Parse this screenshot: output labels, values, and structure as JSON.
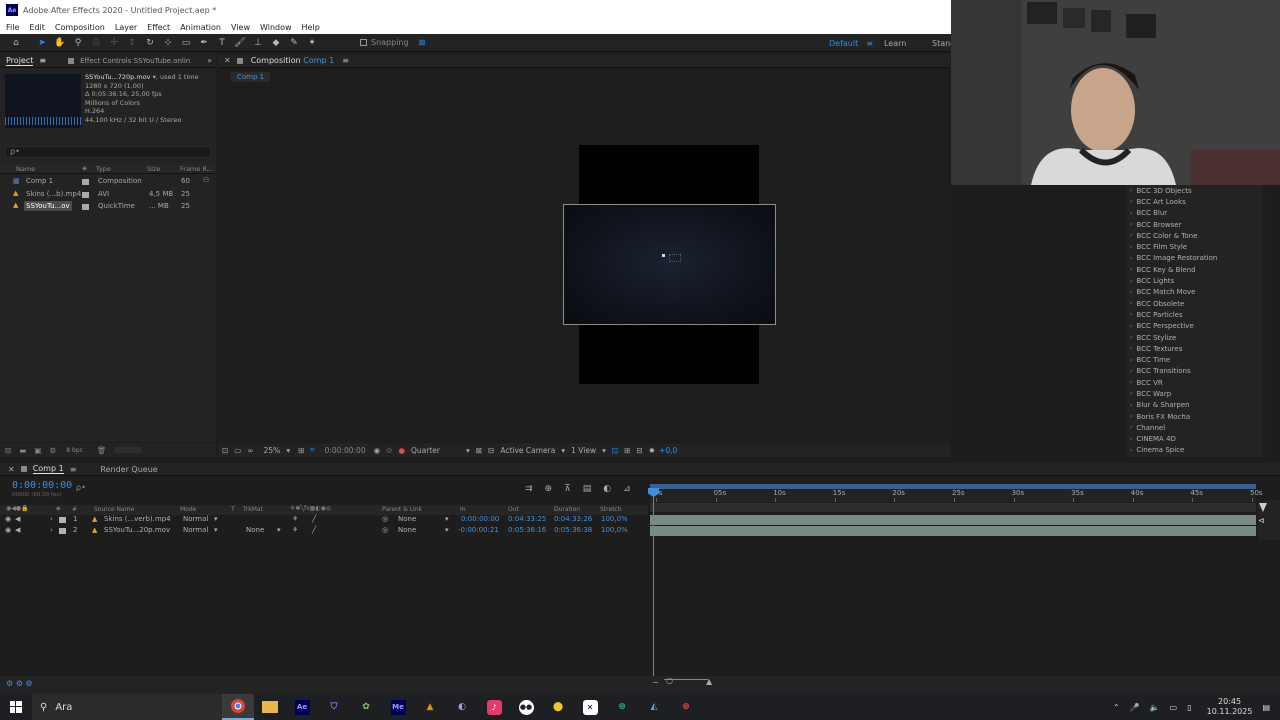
{
  "window": {
    "title": "Adobe After Effects 2020 - Untitled Project.aep *",
    "logo": "Ae"
  },
  "menu": [
    "File",
    "Edit",
    "Composition",
    "Layer",
    "Effect",
    "Animation",
    "View",
    "Window",
    "Help"
  ],
  "toolbar": {
    "snapping": "Snapping",
    "workspace": "Default",
    "learn": "Learn",
    "standard": "Stand"
  },
  "project": {
    "tab": "Project",
    "effect_controls_tab": "Effect Controls SSYouTube.onlin",
    "footage": {
      "name": "SSYouTu...720p.mov",
      "used": ", used 1 time",
      "dims": "1280 x 720 (1,00)",
      "duration": "Δ 0:05:36:16, 25,00 fps",
      "colors": "Millions of Colors",
      "codec": "H.264",
      "audio": "44,100 kHz / 32 bit U / Stereo"
    },
    "search_placeholder": "ρ•",
    "columns": {
      "name": "Name",
      "type": "Type",
      "size": "Size",
      "frame": "Frame R..."
    },
    "items": [
      {
        "name": "Comp 1",
        "type": "Composition",
        "size": "",
        "frame": "60",
        "color": "#5a8bc0"
      },
      {
        "name": "Skins (...b).mp4",
        "type": "AVI",
        "size": "4,5 MB",
        "frame": "25",
        "color": "#e0a030"
      },
      {
        "name": "SSYouTu...ov",
        "type": "QuickTime",
        "size": "... MB",
        "frame": "25",
        "color": "#e0a030"
      }
    ],
    "bpc": "8 bpc"
  },
  "composition": {
    "tab_prefix": "Composition",
    "tab_name": "Comp 1",
    "breadcrumb": "Comp 1"
  },
  "viewer": {
    "zoom": "25%",
    "timecode": "0:00:00:00",
    "resolution": "Quarter",
    "camera": "Active Camera",
    "views": "1 View",
    "exposure": "+0,0"
  },
  "effects": [
    "BCC 3D Objects",
    "BCC Art Looks",
    "BCC Blur",
    "BCC Browser",
    "BCC Color & Tone",
    "BCC Film Style",
    "BCC Image Restoration",
    "BCC Key & Blend",
    "BCC Lights",
    "BCC Match Move",
    "BCC Obsolete",
    "BCC Particles",
    "BCC Perspective",
    "BCC Stylize",
    "BCC Textures",
    "BCC Time",
    "BCC Transitions",
    "BCC VR",
    "BCC Warp",
    "Blur & Sharpen",
    "Boris FX Mocha",
    "Channel",
    "CINEMA 4D",
    "Cinema Spice"
  ],
  "timeline": {
    "tab": "Comp 1",
    "render_queue": "Render Queue",
    "current_time": "0:00:00:00",
    "fps_sub": "00000 (60,00 fps)",
    "columns": {
      "num": "#",
      "source": "Source Name",
      "mode": "Mode",
      "t": "T",
      "trkmat": "TrkMat",
      "parent": "Parent & Link",
      "in": "In",
      "out": "Out",
      "duration": "Duration",
      "stretch": "Stretch"
    },
    "layers": [
      {
        "num": "1",
        "name": "Skins (...verb).mp4",
        "mode": "Normal",
        "trkmat": "",
        "parent": "None",
        "in": "0:00:00:00",
        "out": "0:04:33:25",
        "duration": "0:04:33:26",
        "stretch": "100,0%"
      },
      {
        "num": "2",
        "name": "SSYouTu...20p.mov",
        "mode": "Normal",
        "trkmat": "None",
        "parent": "None",
        "in": "-0:00:00:21",
        "out": "0:05:36:16",
        "duration": "0:05:36:38",
        "stretch": "100,0%"
      }
    ],
    "ticks": [
      "0s",
      "05s",
      "10s",
      "15s",
      "20s",
      "25s",
      "30s",
      "35s",
      "40s",
      "45s",
      "50s"
    ]
  },
  "taskbar": {
    "search": "Ara",
    "time": "20:45",
    "date": "10.11.2025",
    "apps": [
      "chrome-icon",
      "folder-icon",
      "ae-icon",
      "shield-icon",
      "app-icon",
      "me-icon",
      "vlc-icon",
      "browser-icon",
      "tiktok-icon",
      "discord-icon",
      "maps-icon",
      "capcut-icon",
      "xbox-icon",
      "steam-icon",
      "gyro-icon"
    ]
  },
  "colors": {
    "accent": "#2d8ceb",
    "timecode": "#3e8fdc"
  }
}
